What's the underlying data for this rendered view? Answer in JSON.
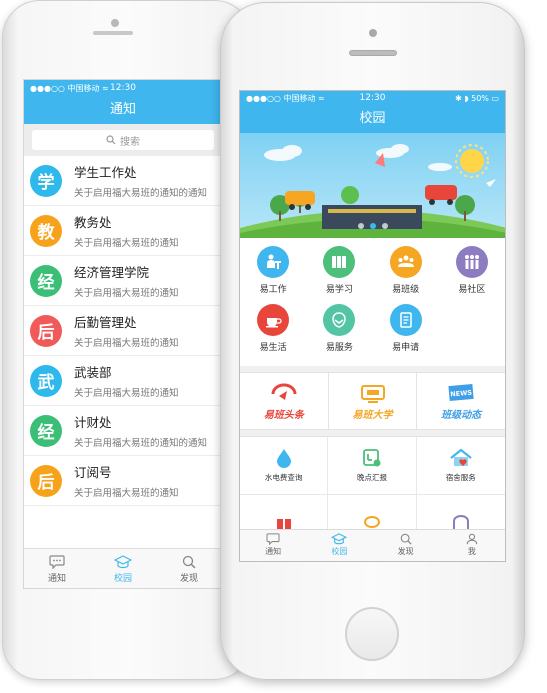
{
  "back_phone": {
    "status": {
      "carrier": "●●●○○ 中国移动 ≈",
      "time": "12:30"
    },
    "nav_title": "通知",
    "search_placeholder": "搜索",
    "items": [
      {
        "avatar": "学",
        "color": "#2eb8ec",
        "title": "学生工作处",
        "subtitle": "关于启用福大易班的通知的通知"
      },
      {
        "avatar": "教",
        "color": "#f7a21b",
        "title": "教务处",
        "subtitle": "关于启用福大易班的通知"
      },
      {
        "avatar": "经",
        "color": "#3bbf76",
        "title": "经济管理学院",
        "subtitle": "关于启用福大易班的通知"
      },
      {
        "avatar": "后",
        "color": "#f05a5a",
        "title": "后勤管理处",
        "subtitle": "关于启用福大易班的通知"
      },
      {
        "avatar": "武",
        "color": "#2eb8ec",
        "title": "武装部",
        "subtitle": "关于启用福大易班的通知"
      },
      {
        "avatar": "经",
        "color": "#3bbf76",
        "title": "计财处",
        "subtitle": "关于启用福大易班的通知的通知"
      },
      {
        "avatar": "后",
        "color": "#f7a21b",
        "title": "订阅号",
        "subtitle": "关于启用福大易班的通知"
      }
    ],
    "tabs": [
      "通知",
      "校园",
      "发现"
    ]
  },
  "front_phone": {
    "status": {
      "carrier": "●●●○○ 中国移动 ≈",
      "time": "12:30",
      "battery": "✱ ◗ 50% ▭"
    },
    "nav_title": "校园",
    "grid": [
      {
        "label": "易工作",
        "color": "#3fb7ee",
        "icon": "work-icon"
      },
      {
        "label": "易学习",
        "color": "#4cbf7a",
        "icon": "book-icon"
      },
      {
        "label": "易班级",
        "color": "#f5a623",
        "icon": "class-icon"
      },
      {
        "label": "易社区",
        "color": "#8e7cc3",
        "icon": "community-icon"
      },
      {
        "label": "易生活",
        "color": "#e9463b",
        "icon": "cup-icon"
      },
      {
        "label": "易服务",
        "color": "#53c5a5",
        "icon": "service-icon"
      },
      {
        "label": "易申请",
        "color": "#3fb7ee",
        "icon": "apply-icon"
      }
    ],
    "features": [
      {
        "label": "易班头条",
        "color": "#e9463b",
        "icon": "headline-icon"
      },
      {
        "label": "易班大学",
        "color": "#f5a623",
        "icon": "university-icon"
      },
      {
        "label": "班级动态",
        "color": "#3f9ee6",
        "icon": "news-icon",
        "badge": "NEWS"
      }
    ],
    "services": [
      {
        "label": "水电费查询",
        "icon": "water-drop-icon",
        "color": "#3fb7ee"
      },
      {
        "label": "晚点汇报",
        "icon": "clock-report-icon",
        "color": "#4cbf7a"
      },
      {
        "label": "宿舍服务",
        "icon": "dorm-icon",
        "color": "#3fb7ee"
      },
      {
        "label": "",
        "icon": "gift-icon",
        "color": "#e9463b"
      },
      {
        "label": "",
        "icon": "chat-icon",
        "color": "#f5a623"
      },
      {
        "label": "",
        "icon": "arch-icon",
        "color": "#8e7cc3"
      }
    ],
    "tabs": [
      "通知",
      "校园",
      "发现",
      "我"
    ]
  }
}
